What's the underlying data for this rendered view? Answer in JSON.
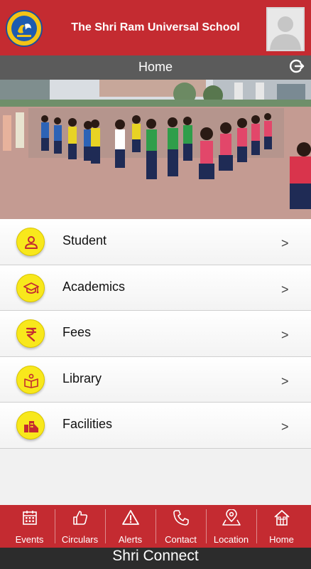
{
  "header": {
    "school_name": "The Shri Ram Universal School",
    "brand_color": "#c42b31",
    "logo_icon": "school-logo-icon",
    "avatar_icon": "user-avatar-icon"
  },
  "titlebar": {
    "title": "Home",
    "logout_icon": "logout-icon"
  },
  "banner": {
    "subject": "students-assembly-photo"
  },
  "menu": {
    "items": [
      {
        "label": "Student",
        "icon": "person-icon"
      },
      {
        "label": "Academics",
        "icon": "graduation-cap-icon"
      },
      {
        "label": "Fees",
        "icon": "rupee-icon"
      },
      {
        "label": "Library",
        "icon": "book-reader-icon"
      },
      {
        "label": "Facilities",
        "icon": "buildings-icon"
      }
    ],
    "chevron": ">",
    "icon_color": "#f8e81c"
  },
  "tabbar": {
    "tabs": [
      {
        "label": "Events",
        "icon": "calendar-icon"
      },
      {
        "label": "Circulars",
        "icon": "thumbs-up-icon"
      },
      {
        "label": "Alerts",
        "icon": "warning-icon"
      },
      {
        "label": "Contact",
        "icon": "phone-icon"
      },
      {
        "label": "Location",
        "icon": "map-pin-icon"
      },
      {
        "label": "Home",
        "icon": "home-icon"
      }
    ]
  },
  "footer": {
    "app_name": "Shri Connect"
  }
}
